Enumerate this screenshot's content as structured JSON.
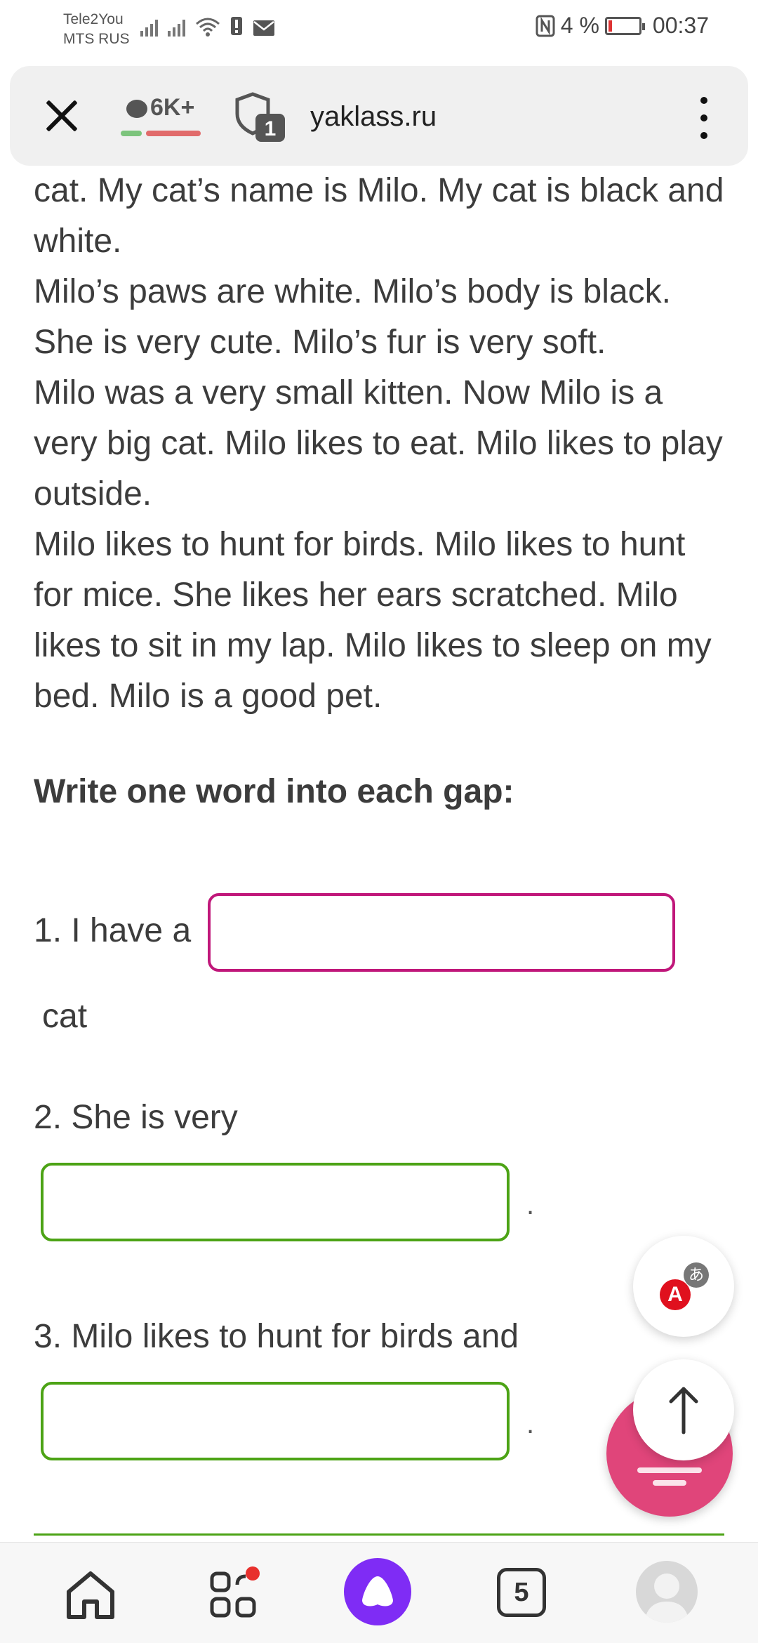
{
  "status_bar": {
    "carrier_1": "Tele2You",
    "carrier_2": "MTS RUS",
    "battery_percent": "4 %",
    "time": "00:37"
  },
  "browser": {
    "comments_count": "6K+",
    "tab_badge": "1",
    "domain": "yaklass.ru"
  },
  "reading": {
    "paragraphs": [
      "cat. My cat’s name is Milo. My cat is black and white.",
      "Milo’s paws are white. Milo’s body is black. She is very cute. Milo’s fur is very soft.",
      "Milo was a very small kitten. Now Milo is a very big cat. Milo likes to eat. Milo likes to play outside.",
      "Milo likes to hunt for birds. Milo likes to hunt for mice. She likes her ears scratched. Milo likes to sit in my lap. Milo likes to sleep on my bed. Milo is a good pet."
    ]
  },
  "exercise": {
    "instruction": "Write one word into each gap:",
    "q1_text": "1. I have a",
    "q1_after": "cat",
    "q1_value": "",
    "q2_text": "2. She is very",
    "q2_after": ".",
    "q2_value": "",
    "q3_text": "3. Milo likes to hunt for birds and",
    "q3_after": ".",
    "q3_value": ""
  },
  "translate": {
    "letter_a": "A",
    "letter_b": "あ"
  },
  "bottom_nav": {
    "tabs_count": "5"
  },
  "colors": {
    "pink_border": "#c0177a",
    "green_border": "#4ca315",
    "alice_purple": "#7f2cf5",
    "fab_pink": "#e0457a"
  }
}
